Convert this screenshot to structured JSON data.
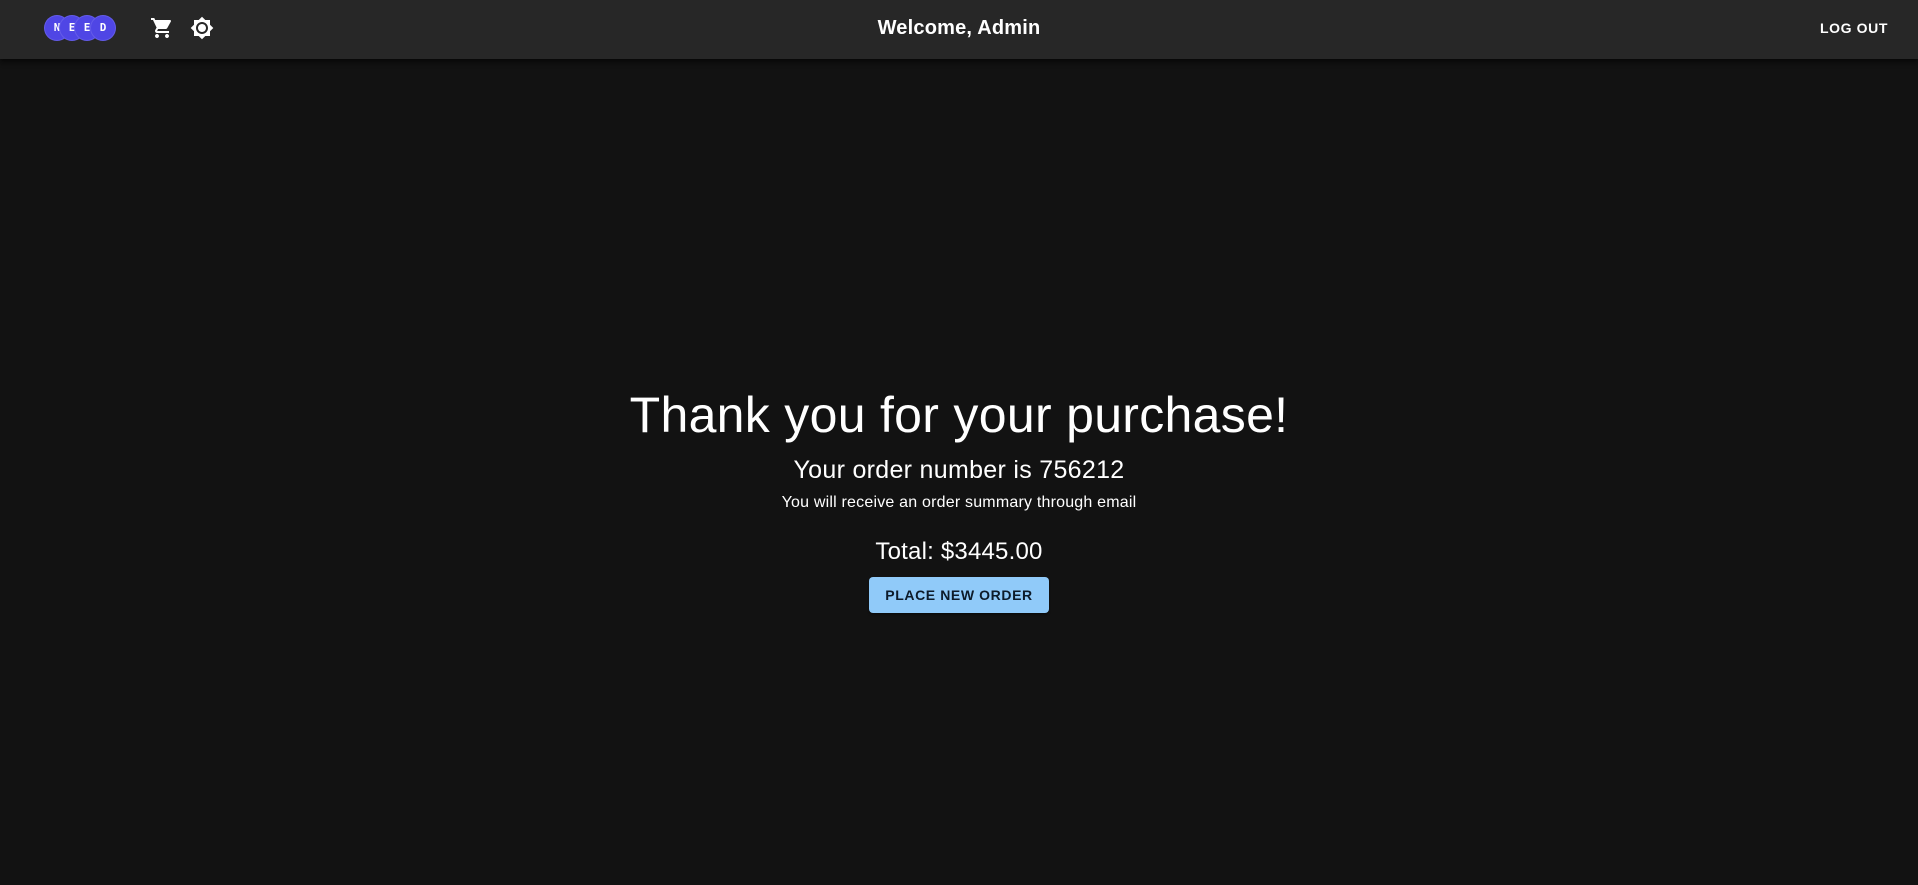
{
  "header": {
    "logo_letters": [
      "N",
      "E",
      "E",
      "D"
    ],
    "welcome_text": "Welcome, Admin",
    "logout_label": "LOG OUT",
    "icons": [
      "cart-icon",
      "brightness-icon"
    ]
  },
  "main": {
    "heading": "Thank you for your purchase!",
    "order_text": "Your order number is 756212",
    "summary_text": "You will receive an order summary through email",
    "total_text": "Total: $3445.00",
    "new_order_label": "PLACE NEW ORDER"
  },
  "colors": {
    "background": "#121212",
    "appbar": "#272727",
    "logo": "#4f46e5",
    "button": "#90caf9",
    "text": "#ffffff"
  }
}
